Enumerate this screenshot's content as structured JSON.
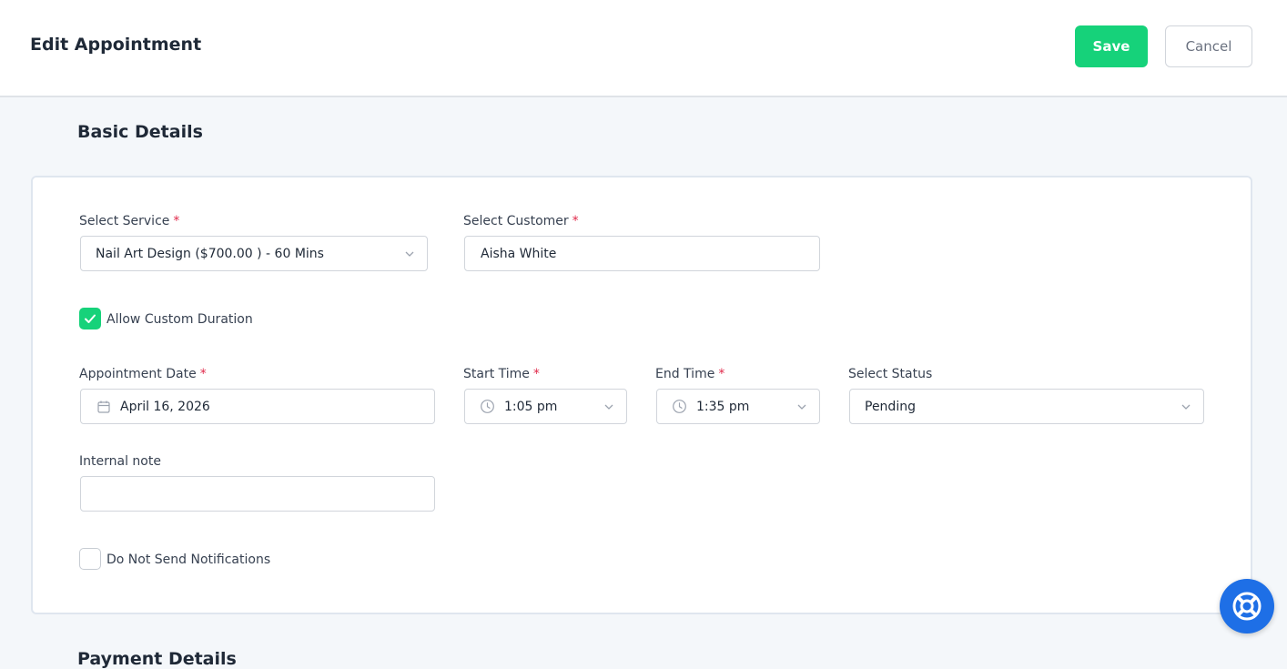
{
  "header": {
    "title": "Edit Appointment",
    "save_label": "Save",
    "cancel_label": "Cancel"
  },
  "section": {
    "title": "Basic Details",
    "next_title": "Payment Details"
  },
  "form": {
    "service": {
      "label": "Select Service",
      "required": "*",
      "value": "Nail Art Design ($700.00 ) - 60 Mins"
    },
    "customer": {
      "label": "Select Customer",
      "required": "*",
      "value": "Aisha White"
    },
    "custom_duration": {
      "label": "Allow Custom Duration",
      "checked": true
    },
    "date": {
      "label": "Appointment Date",
      "required": "*",
      "value": "April 16, 2026"
    },
    "start_time": {
      "label": "Start Time",
      "required": "*",
      "value": "1:05 pm"
    },
    "end_time": {
      "label": "End Time",
      "required": "*",
      "value": "1:35 pm"
    },
    "status": {
      "label": "Select Status",
      "value": "Pending"
    },
    "note": {
      "label": "Internal note",
      "value": ""
    },
    "no_notifications": {
      "label": "Do Not Send Notifications",
      "checked": false
    }
  },
  "icons": {
    "calendar": "calendar-icon",
    "clock": "clock-icon",
    "chevron": "chevron-down-icon",
    "check": "check-icon",
    "help": "lifebuoy-icon"
  },
  "colors": {
    "accent": "#16d27a",
    "required": "#e0294a",
    "help_button": "#1e6fe6"
  }
}
